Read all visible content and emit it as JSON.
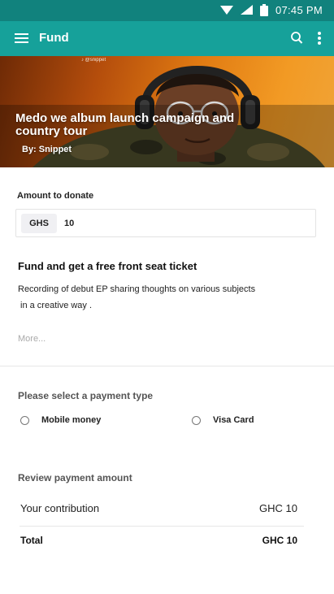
{
  "status_bar": {
    "time": "07:45 PM"
  },
  "app_bar": {
    "title": "Fund"
  },
  "hero": {
    "watermark": "@snippet",
    "title": "Medo we album launch campaign and country tour",
    "author_prefix": "By:",
    "author_name": "Snippet"
  },
  "donation": {
    "label": "Amount to donate",
    "currency": "GHS",
    "amount": "10"
  },
  "perk": {
    "title": "Fund and get a free front seat ticket",
    "description_line1": "Recording of debut EP sharing thoughts on various subjects",
    "description_line2": "in a creative way .",
    "more_link": "More..."
  },
  "payment": {
    "heading": "Please select a payment type",
    "options": [
      {
        "label": "Mobile money"
      },
      {
        "label": "Visa Card"
      }
    ]
  },
  "review": {
    "heading": "Review payment amount",
    "contribution_label": "Your contribution",
    "contribution_value": "GHC 10",
    "total_label": "Total",
    "total_value": "GHC 10"
  },
  "colors": {
    "status_bar": "#11827d",
    "app_bar": "#16a19a",
    "hero_orange": "#e07a12"
  }
}
